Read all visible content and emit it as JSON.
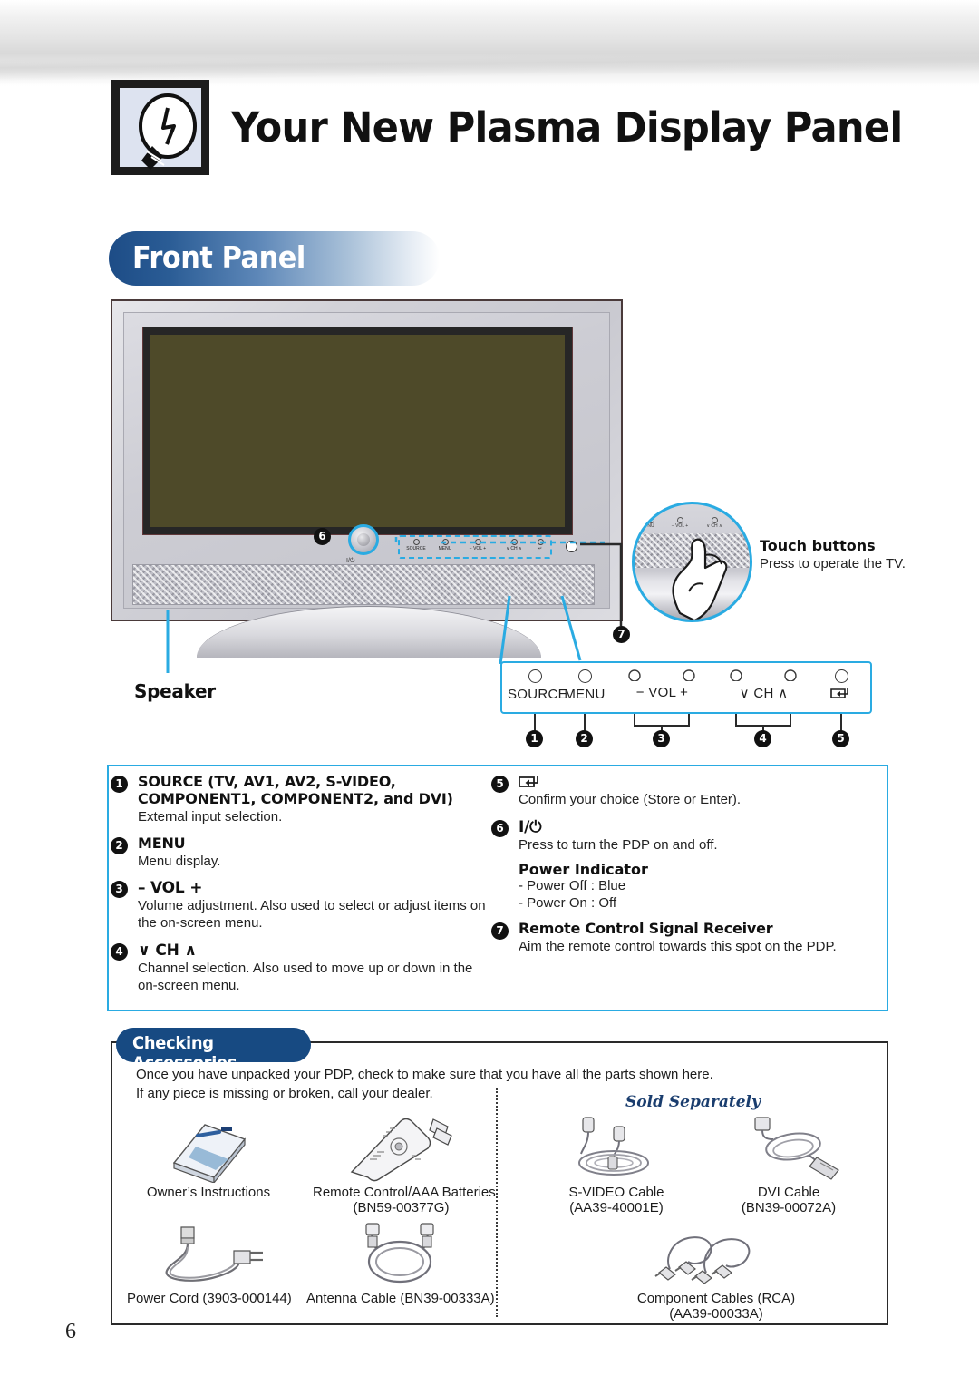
{
  "header": {
    "title": "Your New Plasma Display Panel",
    "icon": "lightbulb-icon"
  },
  "section": {
    "front_panel_label": "Front Panel"
  },
  "tv_diagram": {
    "power_button_label": "I/⏻",
    "callout_6": "6",
    "callout_7": "7",
    "speaker_label": "Speaker",
    "strip_buttons": [
      "SOURCE",
      "MENU",
      "− VOL +",
      "∨ CH ∧",
      "↵"
    ]
  },
  "magnifier": {
    "title": "Touch buttons",
    "subtitle": "Press to operate the TV.",
    "buttons": [
      "NU",
      "− VOL +",
      "∨ CH ∧",
      "↵"
    ]
  },
  "button_panel": {
    "items": [
      {
        "label": "SOURCE",
        "num": "1"
      },
      {
        "label": "MENU",
        "num": "2"
      },
      {
        "label": "−  VOL  +",
        "num": "3"
      },
      {
        "label": "∨  CH  ∧",
        "num": "4"
      },
      {
        "label": "enter-icon",
        "num": "5"
      }
    ]
  },
  "descriptions": {
    "left": [
      {
        "num": "1",
        "heading": "SOURCE (TV, AV1, AV2, S-VIDEO, COMPONENT1, COMPONENT2, and DVI)",
        "body": "External input selection."
      },
      {
        "num": "2",
        "heading": "MENU",
        "body": "Menu display."
      },
      {
        "num": "3",
        "heading": "– VOL +",
        "body": "Volume adjustment. Also used to select or adjust items on the on-screen menu."
      },
      {
        "num": "4",
        "heading": "∨ CH ∧",
        "body": "Channel selection. Also used to move up or down in the on-screen menu."
      }
    ],
    "right": [
      {
        "num": "5",
        "heading": "enter-icon",
        "body": "Confirm your choice (Store or Enter)."
      },
      {
        "num": "6",
        "heading": "I/⏻",
        "body": "Press to turn the PDP on and off.",
        "sub_heading": "Power Indicator",
        "sub_lines": [
          "- Power Off : Blue",
          "- Power On : Off"
        ]
      },
      {
        "num": "7",
        "heading": "Remote Control Signal Receiver",
        "body": "Aim the remote control towards this spot on the PDP."
      }
    ]
  },
  "accessories": {
    "title": "Checking Accessories",
    "intro_line1": "Once you have unpacked your PDP, check to make sure that you have all the parts shown here.",
    "intro_line2": "If any piece is missing or broken, call your dealer.",
    "sold_separately_label": "Sold Separately",
    "included": [
      {
        "name": "Owner’s Instructions",
        "code": "",
        "art": "manual-icon"
      },
      {
        "name": "Remote Control/AAA Batteries",
        "code": "(BN59-00377G)",
        "art": "remote-icon"
      },
      {
        "name": "Power Cord (3903-000144)",
        "code": "",
        "art": "power-cord-icon"
      },
      {
        "name": "Antenna Cable (BN39-00333A)",
        "code": "",
        "art": "antenna-cable-icon"
      }
    ],
    "sold_separately": [
      {
        "name": "S-VIDEO Cable",
        "code": "(AA39-40001E)",
        "art": "svideo-cable-icon"
      },
      {
        "name": "DVI Cable",
        "code": "(BN39-00072A)",
        "art": "dvi-cable-icon"
      },
      {
        "name": "Component Cables (RCA)",
        "code": "(AA39-00033A)",
        "art": "component-cable-icon"
      }
    ]
  },
  "footer": {
    "page_number": "6"
  },
  "colors": {
    "accent_blue": "#2aabe2",
    "pill_blue": "#1d4c86",
    "box_border": "#2a2a2a",
    "screen": "#4e4a29"
  }
}
